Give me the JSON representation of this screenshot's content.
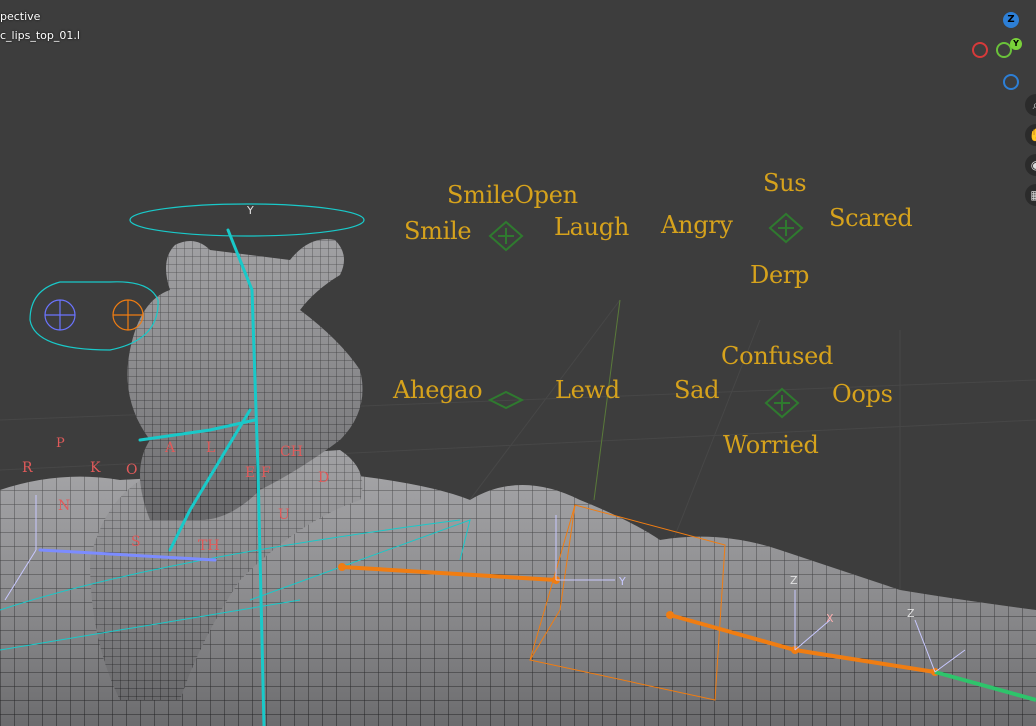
{
  "viewport": {
    "view_mode": "pective",
    "active_object": "c_lips_top_01.l"
  },
  "expressions": {
    "smile_open": "SmileOpen",
    "smile": "Smile",
    "laugh": "Laugh",
    "angry": "Angry",
    "sus": "Sus",
    "scared": "Scared",
    "derp": "Derp",
    "ahegao": "Ahegao",
    "lewd": "Lewd",
    "sad": "Sad",
    "confused": "Confused",
    "oops": "Oops",
    "worried": "Worried"
  },
  "phonemes": {
    "p": "P",
    "r": "R",
    "k": "K",
    "o": "O",
    "n": "N",
    "s": "S",
    "th": "TH",
    "ch": "CH",
    "d": "D",
    "u": "U",
    "e": "E",
    "f": "F",
    "a": "A",
    "l": "L"
  },
  "gizmo": {
    "z": "Z",
    "y": "Y",
    "x": "X"
  },
  "axis_labels": {
    "y": "Y",
    "z": "Z",
    "x": "X"
  },
  "colors": {
    "background": "#3d3d3d",
    "expression_text": "#d6a21c",
    "mesh": "#8a8a8c",
    "wire": "#2a2a2a",
    "bone_cyan": "#19c9c9",
    "bone_orange": "#f07d12"
  },
  "icons": {
    "zoom": "magnifier-icon",
    "pan": "hand-icon",
    "camera": "camera-icon",
    "ortho": "grid-icon"
  }
}
